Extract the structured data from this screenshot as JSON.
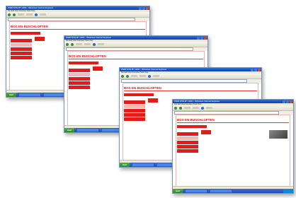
{
  "windows": [
    {
      "title": "WEB SITE BY HDD   - Windows Internet Explorer",
      "menu": "File  Edit  View  Favorites  Tools  Help",
      "site_title": "BOS EN BUSCHLOPTEN",
      "main_text": ""
    },
    {
      "title": "WEB SITE BY HDD   - Windows Internet Explorer",
      "menu": "File  Edit  View  Favorites  Tools  Help",
      "site_title": "BOS EN BUSCHLOPTEN",
      "main_text": ""
    },
    {
      "title": "WEB SITE BY HDD   - Windows Internet Explorer",
      "menu": "File  Edit  View  Favorites  Tools  Help",
      "site_title": "BOS EN BUSCHLOPTEN",
      "main_text": ""
    },
    {
      "title": "WEB SITE BY HDD   - Windows Internet Explorer",
      "menu": "File  Edit  View  Favorites  Tools  Help",
      "site_title": "BOS EN BUSCHLOPTEN",
      "main_text": ""
    }
  ],
  "taskbar": {
    "start_label": "start"
  },
  "colors": {
    "brand_red": "#e41b1b",
    "xp_blue": "#1c4fb7",
    "start_green": "#3b9a3b"
  }
}
